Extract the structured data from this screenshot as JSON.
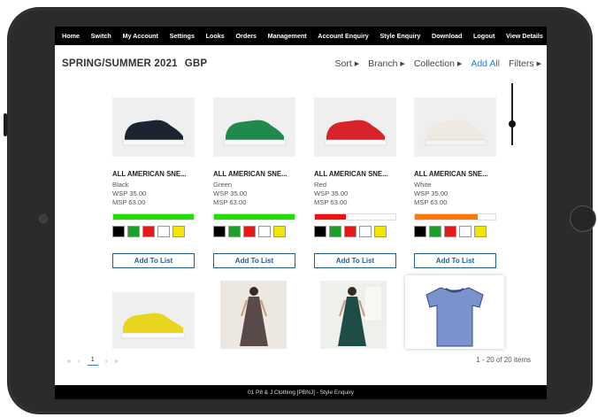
{
  "nav": {
    "items": [
      "Home",
      "Switch",
      "My Account",
      "Settings",
      "Looks",
      "Orders",
      "Management",
      "Account Enquiry",
      "Style Enquiry",
      "Download",
      "Logout",
      "View Details"
    ]
  },
  "header": {
    "title": "SPRING/SUMMER 2021",
    "currency": "GBP"
  },
  "toolbar": {
    "sort": "Sort",
    "branch": "Branch",
    "collection": "Collection",
    "add_all": "Add All",
    "filters": "Filters"
  },
  "colors": {
    "accent": "#2a7bc0",
    "button_border": "#1f5f8e",
    "stock_green": "#22dd00",
    "stock_red": "#ee1111",
    "stock_orange": "#ff7700"
  },
  "products": [
    {
      "name": "ALL AMERICAN SNE...",
      "color": "Black",
      "wsp": "WSP 35.00",
      "msp": "MSP 63.00",
      "shoe_color": "#1b2430",
      "stock_color": "#22dd00",
      "stock_level": 1.0,
      "swatches": [
        "#000000",
        "#1e9e2a",
        "#e3191b",
        "#ffffff",
        "#f2e600"
      ],
      "button": "Add To List"
    },
    {
      "name": "ALL AMERICAN SNE...",
      "color": "Green",
      "wsp": "WSP 35.00",
      "msp": "MSP 63.00",
      "shoe_color": "#1f8a4c",
      "stock_color": "#22dd00",
      "stock_level": 1.0,
      "swatches": [
        "#000000",
        "#1e9e2a",
        "#e3191b",
        "#ffffff",
        "#f2e600"
      ],
      "button": "Add To List"
    },
    {
      "name": "ALL AMERICAN SNE...",
      "color": "Red",
      "wsp": "WSP 35.00",
      "msp": "MSP 63.00",
      "shoe_color": "#d8232a",
      "stock_color": "#ee1111",
      "stock_level": 0.38,
      "swatches": [
        "#000000",
        "#1e9e2a",
        "#e3191b",
        "#ffffff",
        "#f2e600"
      ],
      "button": "Add To List"
    },
    {
      "name": "ALL AMERICAN SNE...",
      "color": "White",
      "wsp": "WSP 35.00",
      "msp": "MSP 63.00",
      "shoe_color": "#eeeae2",
      "stock_color": "#ff7700",
      "stock_level": 0.78,
      "swatches": [
        "#000000",
        "#1e9e2a",
        "#e3191b",
        "#ffffff",
        "#f2e600"
      ],
      "button": "Add To List"
    }
  ],
  "pager": {
    "first": "«",
    "prev": "‹",
    "current": "1",
    "next": "›",
    "last": "»",
    "info": "1 - 20 of 20 items"
  },
  "footer": {
    "text": "01 P8 & J Clothing [PBNJ] - Style Enquiry"
  }
}
